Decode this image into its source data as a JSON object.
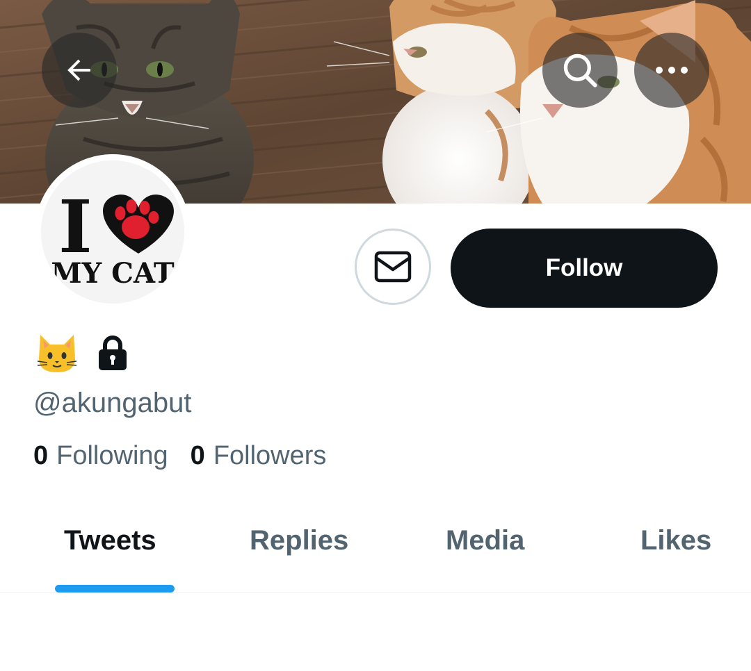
{
  "profile": {
    "display_name_emoji": "🐱",
    "handle": "@akungabut",
    "protected": true,
    "avatar_text_top": "I",
    "avatar_text_bottom": "MY CAT"
  },
  "header": {
    "back_icon": "arrow-left-icon",
    "search_icon": "search-icon",
    "more_icon": "more-horizontal-icon"
  },
  "actions": {
    "message_icon": "mail-icon",
    "follow_label": "Follow"
  },
  "stats": {
    "following_count": "0",
    "following_label": "Following",
    "followers_count": "0",
    "followers_label": "Followers"
  },
  "tabs": [
    {
      "label": "Tweets",
      "active": true
    },
    {
      "label": "Replies",
      "active": false
    },
    {
      "label": "Media",
      "active": false
    },
    {
      "label": "Likes",
      "active": false
    }
  ],
  "colors": {
    "accent": "#1d9bf0",
    "text_primary": "#0f1419",
    "text_secondary": "#536471",
    "follow_button_bg": "#0f1419"
  }
}
